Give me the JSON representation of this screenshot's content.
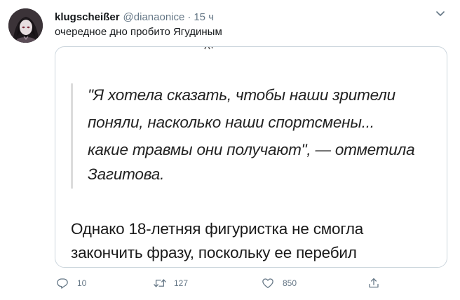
{
  "author": {
    "display_name": "klugscheißer",
    "handle": "@dianaonice",
    "separator": "·",
    "time": "15 ч"
  },
  "tweet": {
    "text": "очередное дно пробито Ягудиным"
  },
  "media": {
    "quote_lines": [
      "\"Я хотела сказать, чтобы наши зрители",
      "поняли, насколько наши спортсмены...",
      "какие травмы они получают\", — отметила",
      "Загитова."
    ],
    "body_lines": [
      "Однако 18-летняя фигуристка не смогла",
      "закончить фразу, поскольку ее перебил"
    ]
  },
  "actions": {
    "reply_count": "10",
    "retweet_count": "127",
    "like_count": "850"
  },
  "icons": {
    "menu": "chevron-down-icon",
    "reply": "reply-icon",
    "retweet": "retweet-icon",
    "like": "heart-icon",
    "share": "share-icon"
  },
  "colors": {
    "secondary_text": "#657786",
    "icon": "#657786",
    "card_border": "#ccd6dd"
  }
}
